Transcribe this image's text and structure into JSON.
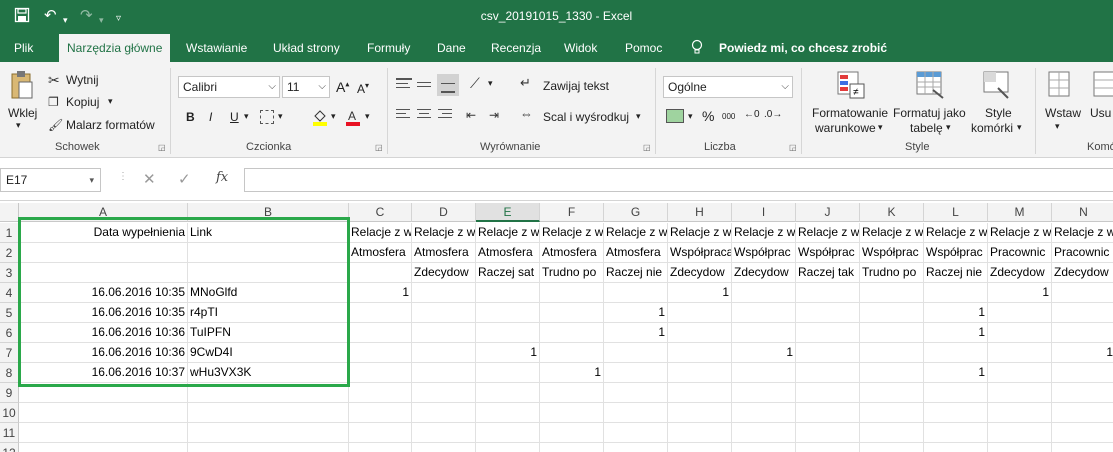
{
  "window": {
    "title": "csv_20191015_1330  -  Excel"
  },
  "quick_access": {
    "save": "save-icon",
    "undo": "undo-icon",
    "redo": "redo-icon",
    "customize": "customize-icon"
  },
  "tabs": [
    {
      "label": "Plik",
      "active": false
    },
    {
      "label": "Narzędzia główne",
      "active": true
    },
    {
      "label": "Wstawianie",
      "active": false
    },
    {
      "label": "Układ strony",
      "active": false
    },
    {
      "label": "Formuły",
      "active": false
    },
    {
      "label": "Dane",
      "active": false
    },
    {
      "label": "Recenzja",
      "active": false
    },
    {
      "label": "Widok",
      "active": false
    },
    {
      "label": "Pomoc",
      "active": false
    }
  ],
  "tell_me": "Powiedz mi, co chcesz zrobić",
  "ribbon": {
    "clipboard": {
      "paste": "Wklej",
      "cut": "Wytnij",
      "copy": "Kopiuj",
      "format_painter": "Malarz formatów",
      "group": "Schowek"
    },
    "font": {
      "name": "Calibri",
      "size": "11",
      "group": "Czcionka",
      "bold": "B",
      "italic": "I",
      "underline": "U",
      "grow": "A",
      "shrink": "A"
    },
    "alignment": {
      "wrap": "Zawijaj tekst",
      "merge": "Scal i wyśrodkuj",
      "group": "Wyrównanie"
    },
    "number": {
      "format": "Ogólne",
      "group": "Liczba",
      "percent": "%",
      "comma": "000"
    },
    "styles": {
      "conditional_1": "Formatowanie",
      "conditional_2": "warunkowe",
      "table_1": "Formatuj jako",
      "table_2": "tabelę",
      "cell_1": "Style",
      "cell_2": "komórki",
      "group": "Style"
    },
    "cells": {
      "insert": "Wstaw",
      "delete": "Usu",
      "group": "Komó"
    }
  },
  "formula_bar": {
    "name_box": "E17",
    "fx": "fx",
    "cancel": "✕",
    "enter": "✓",
    "value": ""
  },
  "columns": [
    {
      "label": "A"
    },
    {
      "label": "B"
    },
    {
      "label": "C"
    },
    {
      "label": "D"
    },
    {
      "label": "E",
      "selected": true
    },
    {
      "label": "F"
    },
    {
      "label": "G"
    },
    {
      "label": "H"
    },
    {
      "label": "I"
    },
    {
      "label": "J"
    },
    {
      "label": "K"
    },
    {
      "label": "L"
    },
    {
      "label": "M"
    },
    {
      "label": "N"
    }
  ],
  "rows": [
    {
      "num": "1",
      "cells": [
        "Data wypełnienia",
        "Link",
        "Relacje z w",
        "Relacje z w",
        "Relacje z w",
        "Relacje z w",
        "Relacje z w",
        "Relacje z w",
        "Relacje z w",
        "Relacje z w",
        "Relacje z w",
        "Relacje z w",
        "Relacje z w",
        "Relacje z w"
      ]
    },
    {
      "num": "2",
      "cells": [
        "",
        "",
        "Atmosfera",
        "Atmosfera",
        "Atmosfera",
        "Atmosfera",
        "Atmosfera",
        "Współpraca",
        "Współprac",
        "Współprac",
        "Współprac",
        "Współprac",
        "Pracownic",
        "Pracownic"
      ]
    },
    {
      "num": "3",
      "cells": [
        "",
        "",
        "",
        "Zdecydow",
        "Raczej sat",
        "Trudno po",
        "Raczej nie",
        "Zdecydow",
        "Zdecydow",
        "Raczej tak",
        "Trudno po",
        "Raczej nie",
        "Zdecydow",
        "Zdecydow"
      ]
    },
    {
      "num": "4",
      "cells": [
        "16.06.2016 10:35",
        "MNoGlfd",
        "1",
        "",
        "",
        "",
        "",
        "1",
        "",
        "",
        "",
        "",
        "1",
        ""
      ]
    },
    {
      "num": "5",
      "cells": [
        "16.06.2016 10:35",
        "r4pTI",
        "",
        "",
        "",
        "",
        "1",
        "",
        "",
        "",
        "",
        "1",
        "",
        ""
      ]
    },
    {
      "num": "6",
      "cells": [
        "16.06.2016 10:36",
        "TuIPFN",
        "",
        "",
        "",
        "",
        "1",
        "",
        "",
        "",
        "",
        "1",
        "",
        ""
      ]
    },
    {
      "num": "7",
      "cells": [
        "16.06.2016 10:36",
        "9CwD4I",
        "",
        "",
        "1",
        "",
        "",
        "",
        "1",
        "",
        "",
        "",
        "",
        "1"
      ]
    },
    {
      "num": "8",
      "cells": [
        "16.06.2016 10:37",
        "wHu3VX3K",
        "",
        "",
        "",
        "1",
        "",
        "",
        "",
        "",
        "",
        "1",
        "",
        ""
      ]
    },
    {
      "num": "9",
      "cells": [
        "",
        "",
        "",
        "",
        "",
        "",
        "",
        "",
        "",
        "",
        "",
        "",
        "",
        ""
      ]
    },
    {
      "num": "10",
      "cells": [
        "",
        "",
        "",
        "",
        "",
        "",
        "",
        "",
        "",
        "",
        "",
        "",
        "",
        ""
      ]
    },
    {
      "num": "11",
      "cells": [
        "",
        "",
        "",
        "",
        "",
        "",
        "",
        "",
        "",
        "",
        "",
        "",
        "",
        ""
      ]
    },
    {
      "num": "12",
      "cells": [
        "",
        "",
        "",
        "",
        "",
        "",
        "",
        "",
        "",
        "",
        "",
        "",
        "",
        ""
      ]
    }
  ],
  "colors": {
    "accent": "#217346",
    "highlight": "#2aa84a"
  }
}
